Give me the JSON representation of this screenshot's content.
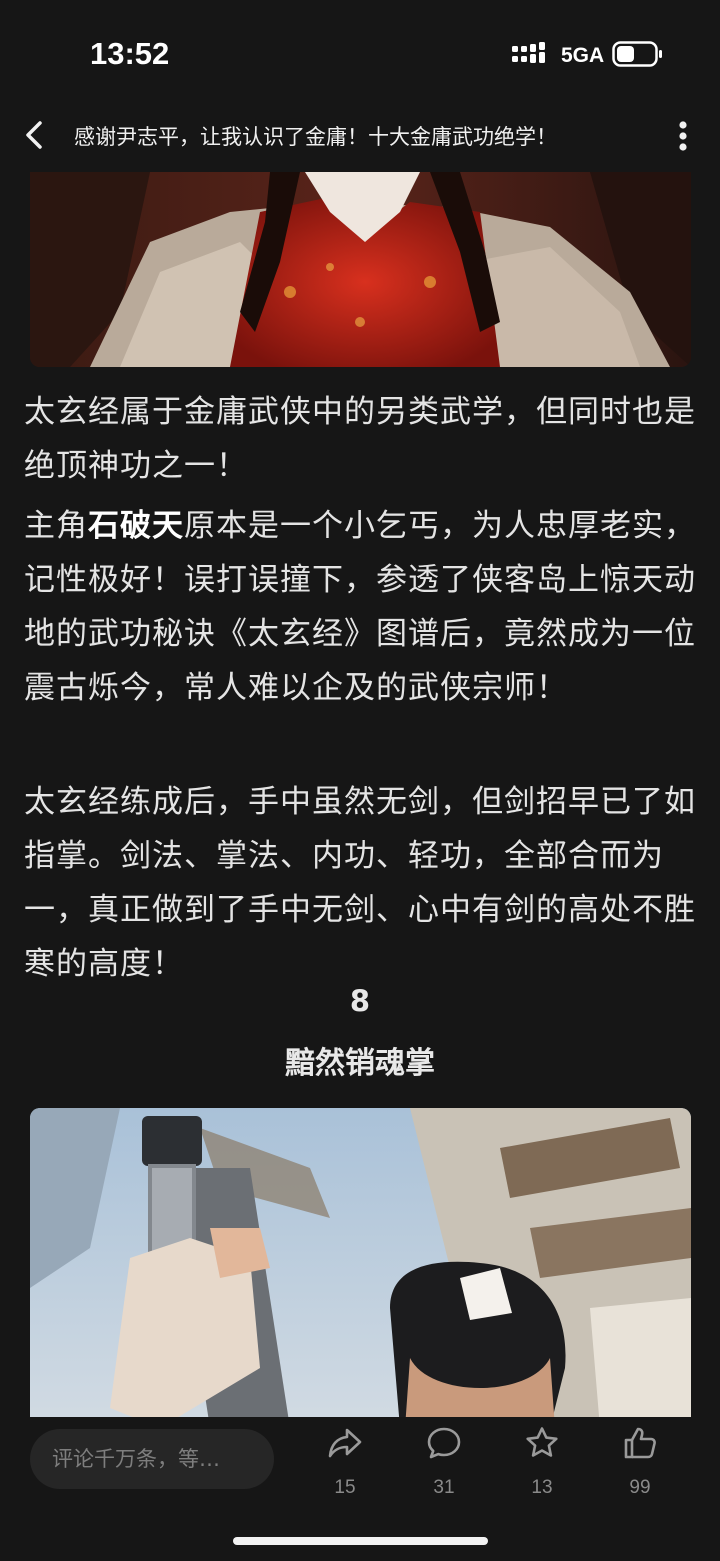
{
  "status_bar": {
    "time": "13:52",
    "network": "5GA",
    "icons": [
      "signal-icon",
      "battery-icon"
    ]
  },
  "header": {
    "title": "感谢尹志平，让我认识了金庸！十大金庸武功绝学！",
    "icons": [
      "back-arrow-icon",
      "more-vertical-icon"
    ]
  },
  "article": {
    "paragraph_1": "太玄经属于金庸武侠中的另类武学，但同时也是绝顶神功之一！",
    "paragraph_2": {
      "prefix": "主角",
      "bold": "石破天",
      "suffix": "原本是一个小乞丐，为人忠厚老实，记性极好！误打误撞下，参透了侠客岛上惊天动地的武功秘诀《太玄经》图谱后，竟然成为一位震古烁今，常人难以企及的武侠宗师！"
    },
    "paragraph_3": "太玄经练成后，手中虽然无剑，但剑招早已了如指掌。剑法、掌法、内功、轻功，全部合而为一，真正做到了手中无剑、心中有剑的高处不胜寒的高度！",
    "section_number": "8",
    "section_title": "黯然销魂掌"
  },
  "bottom_bar": {
    "comment_placeholder": "评论千万条，等…",
    "share_count": "15",
    "comment_count": "31",
    "favorite_count": "13",
    "like_count": "99",
    "icons": [
      "share-icon",
      "comment-icon",
      "star-icon",
      "thumbs-up-icon"
    ]
  }
}
